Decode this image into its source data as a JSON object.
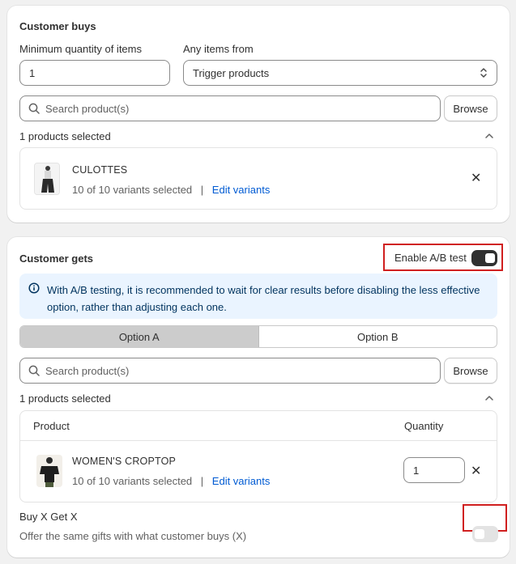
{
  "buys": {
    "title": "Customer buys",
    "min_qty_label": "Minimum quantity of items",
    "min_qty_value": "1",
    "items_from_label": "Any items from",
    "items_from_value": "Trigger products",
    "search_placeholder": "Search product(s)",
    "browse_label": "Browse",
    "selected_count": "1 products selected",
    "product": {
      "name": "CULOTTES",
      "variants": "10 of 10 variants selected",
      "separator": "|",
      "edit_label": "Edit variants"
    }
  },
  "gets": {
    "title": "Customer gets",
    "ab_label": "Enable A/B test",
    "ab_enabled": true,
    "banner_text": "With A/B testing, it is recommended to wait for clear results before disabling the less effective option, rather than adjusting each one.",
    "tabs": [
      {
        "label": "Option A",
        "selected": true
      },
      {
        "label": "Option B",
        "selected": false
      }
    ],
    "search_placeholder": "Search product(s)",
    "browse_label": "Browse",
    "selected_count": "1 products selected",
    "table_headers": {
      "product": "Product",
      "quantity": "Quantity"
    },
    "product": {
      "name": "WOMEN'S CROPTOP",
      "variants": "10 of 10 variants selected",
      "separator": "|",
      "edit_label": "Edit variants",
      "quantity": "1"
    },
    "bxgx": {
      "title": "Buy X Get X",
      "description": "Offer the same gifts with what customer buys (X)",
      "enabled": false
    }
  },
  "colors": {
    "link": "#005bd3",
    "highlight": "#d01f1f",
    "banner_bg": "#eaf4ff"
  }
}
